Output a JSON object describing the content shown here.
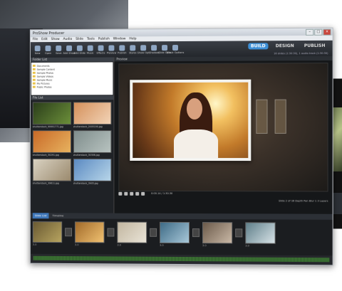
{
  "window": {
    "title": "ProShow Producer",
    "controls": [
      "–",
      "□",
      "×"
    ]
  },
  "menu": [
    "File",
    "Edit",
    "Show",
    "Audio",
    "Slide",
    "Tools",
    "Publish",
    "Window",
    "Help"
  ],
  "toolbar": {
    "buttons": [
      "New",
      "Open",
      "Save",
      "Add Show",
      "Add Slide",
      "Music",
      "Effects",
      "Preview",
      "Publish",
      "Styles",
      "Show Opt",
      "Shadow",
      "Slide Opts",
      "Music Options"
    ],
    "modes": [
      "BUILD",
      "DESIGN",
      "PUBLISH"
    ],
    "status": "16 slides (1:30:30), 1 audio track (1:30:30)"
  },
  "left_pane": {
    "title": "Folder List",
    "folders": [
      "Documents",
      "Sample Content",
      "Sample Photos",
      "Sample Videos",
      "Sample Music",
      "My Pictures",
      "Public Photos"
    ],
    "file_list_title": "File List",
    "files": [
      {
        "name": "shutterstock_99991771.jpg",
        "colors": [
          "#2a3d1a",
          "#6c8f3a"
        ]
      },
      {
        "name": "shutterstock_2005190.jpg",
        "colors": [
          "#d5905a",
          "#f2d4b8"
        ]
      },
      {
        "name": "shutterstock_30291.jpg",
        "colors": [
          "#c96a28",
          "#e7b25f"
        ]
      },
      {
        "name": "shutterstock_30306.jpg",
        "colors": [
          "#7f8d8c",
          "#b8c3c0"
        ]
      },
      {
        "name": "shutterstock_39611.jpg",
        "colors": [
          "#d9d2c2",
          "#9b8a6e"
        ]
      },
      {
        "name": "shutterstock_3905.jpg",
        "colors": [
          "#5b8ac2",
          "#b8d6e9"
        ]
      }
    ]
  },
  "preview": {
    "title": "Preview",
    "time": "0:00.14 / 1:30.30",
    "slide_info": "Slide 2 of 16   Depth Pan Blur 1   3 Layers"
  },
  "timeline": {
    "tabs": [
      "Slide List",
      "Timeline"
    ],
    "slides": [
      {
        "duration": "3.0",
        "colors": [
          "#6a5a33",
          "#b7a460"
        ]
      },
      {
        "duration": "3.0",
        "colors": [
          "#a16a2a",
          "#f0c171"
        ]
      },
      {
        "duration": "3.0",
        "colors": [
          "#c2b6a0",
          "#e9e4d7"
        ]
      },
      {
        "duration": "3.0",
        "colors": [
          "#3e6b86",
          "#a8c7d8"
        ]
      },
      {
        "duration": "3.0",
        "colors": [
          "#6b5a4a",
          "#c9b8a6"
        ]
      },
      {
        "duration": "3.0",
        "colors": [
          "#5f7f8a",
          "#d7e2e6"
        ]
      },
      {
        "duration": "3.0",
        "colors": [
          "#2f5a8a",
          "#9cc0e2"
        ]
      }
    ]
  }
}
